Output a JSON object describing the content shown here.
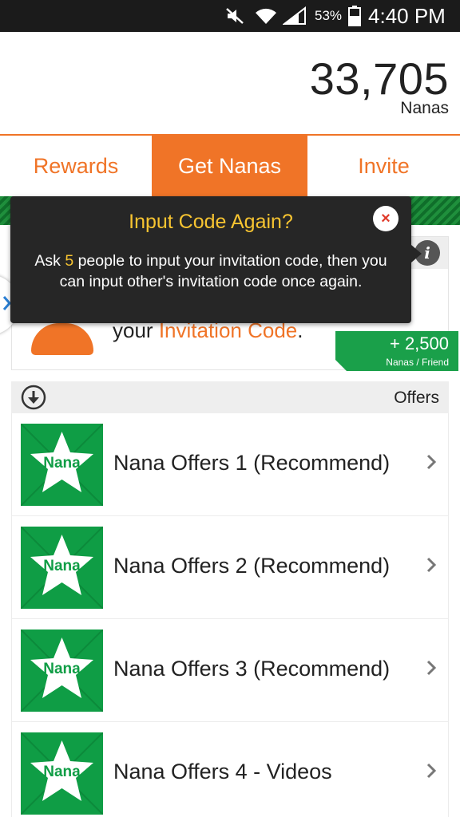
{
  "status_bar": {
    "battery_percent": "53%",
    "time": "4:40 PM",
    "icons": [
      "mute-icon",
      "wifi-icon",
      "signal-icon",
      "battery-icon"
    ]
  },
  "header": {
    "balance": "33,705",
    "balance_unit": "Nanas"
  },
  "tabs": [
    {
      "label": "Rewards",
      "active": false
    },
    {
      "label": "Get Nanas",
      "active": true
    },
    {
      "label": "Invite",
      "active": false
    }
  ],
  "tooltip": {
    "title": "Input Code Again?",
    "body_prefix": "Ask ",
    "body_number": "5",
    "body_suffix": " people to input your invitation code, then you can input other's invitation code once again.",
    "close_label": "×"
  },
  "invite_card": {
    "text_prefix": "your ",
    "text_highlight": "Invitation Code",
    "text_suffix": ".",
    "reward_amount": "+ 2,500",
    "reward_unit": "Nanas / Friend"
  },
  "offers": {
    "title": "Offers",
    "items": [
      {
        "icon_text": "Nana",
        "label": "Nana Offers 1 (Recommend)"
      },
      {
        "icon_text": "Nana",
        "label": "Nana Offers 2 (Recommend)"
      },
      {
        "icon_text": "Nana",
        "label": "Nana Offers 3 (Recommend)"
      },
      {
        "icon_text": "Nana",
        "label": "Nana Offers 4 - Videos"
      }
    ]
  },
  "colors": {
    "accent": "#f07427",
    "green": "#0f9d45",
    "tooltip_bg": "#262626",
    "highlight": "#f7c431"
  }
}
